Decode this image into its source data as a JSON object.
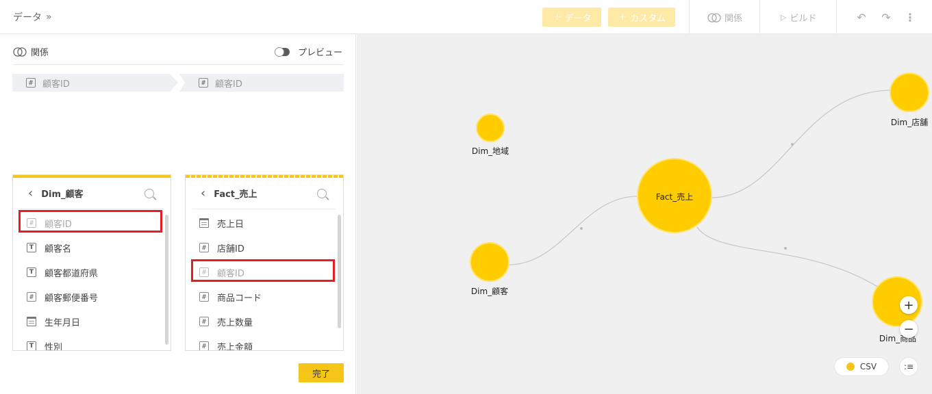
{
  "breadcrumb": {
    "label": "データ",
    "sep": "»"
  },
  "toolbar": {
    "add_data": "データ",
    "add_custom": "カスタム",
    "relation": "関係",
    "build": "ビルド"
  },
  "left": {
    "relation_title": "関係",
    "preview_label": "プレビュー",
    "key_left": "顧客ID",
    "key_right": "顧客ID",
    "done": "完了",
    "cards": [
      {
        "title": "Dim_顧客",
        "fields": [
          {
            "icon": "hash",
            "label": "顧客ID",
            "dim": true
          },
          {
            "icon": "text",
            "label": "顧客名"
          },
          {
            "icon": "text",
            "label": "顧客都道府県"
          },
          {
            "icon": "hash",
            "label": "顧客郵便番号"
          },
          {
            "icon": "calendar",
            "label": "生年月日"
          },
          {
            "icon": "text",
            "label": "性別"
          }
        ]
      },
      {
        "title": "Fact_売上",
        "fields": [
          {
            "icon": "calendar",
            "label": "売上日"
          },
          {
            "icon": "hash",
            "label": "店舗ID"
          },
          {
            "icon": "hash",
            "label": "顧客ID",
            "dim": true
          },
          {
            "icon": "hash",
            "label": "商品コード"
          },
          {
            "icon": "hash",
            "label": "売上数量"
          },
          {
            "icon": "hash",
            "label": "売上金額"
          }
        ]
      }
    ]
  },
  "canvas": {
    "nodes": {
      "dim_chiiki": "Dim_地域",
      "fact_uriage": "Fact_売上",
      "dim_tenpo": "Dim_店舗",
      "dim_kokyaku": "Dim_顧客",
      "dim_shohin": "Dim_商品"
    },
    "legend": "CSV",
    "node_color": "#FFCC00",
    "accent": "#F5C518",
    "highlight": "#E31E24"
  }
}
